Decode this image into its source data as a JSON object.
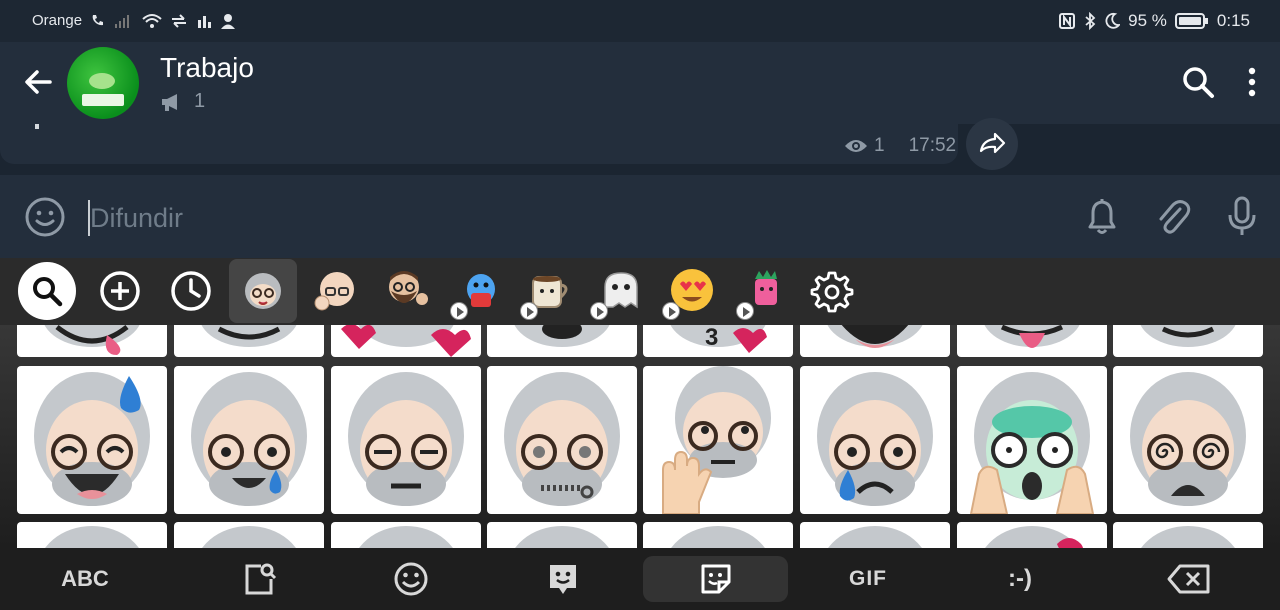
{
  "status_bar": {
    "carrier": "Orange",
    "battery_percent": "95 %",
    "time": "0:15"
  },
  "header": {
    "title": "Trabajo",
    "subscriber_count": "1"
  },
  "message": {
    "views": "1",
    "time": "17:52"
  },
  "input": {
    "placeholder": "Difundir"
  },
  "sticker_tabs": [
    {
      "icon": "search-icon"
    },
    {
      "icon": "add-icon"
    },
    {
      "icon": "recent-clock-icon"
    },
    {
      "icon": "sticker-pack-grandpa",
      "selected": true
    },
    {
      "icon": "sticker-pack-bald-man"
    },
    {
      "icon": "sticker-pack-bearded-man"
    },
    {
      "icon": "sticker-pack-blue-bird"
    },
    {
      "icon": "sticker-pack-coffee-cup"
    },
    {
      "icon": "sticker-pack-ghost"
    },
    {
      "icon": "sticker-pack-heart-eyes"
    },
    {
      "icon": "sticker-pack-pink-creature"
    },
    {
      "icon": "settings-gear-icon"
    }
  ],
  "stickers_row2": [
    {
      "name": "sweat-laugh"
    },
    {
      "name": "crying-smile"
    },
    {
      "name": "eyes-closed"
    },
    {
      "name": "zipped-mouth"
    },
    {
      "name": "hand-raised-eyeroll"
    },
    {
      "name": "crying-sad"
    },
    {
      "name": "screaming-hands"
    },
    {
      "name": "dizzy-eyes"
    }
  ],
  "keyboard_bar": {
    "abc_label": "ABC",
    "gif_label": "GIF",
    "emoticon_label": ":-)"
  },
  "colors": {
    "header_bg": "#232e3c",
    "accent_green": "#0a8f1c",
    "keyboard_bg": "#1e1e1e"
  }
}
